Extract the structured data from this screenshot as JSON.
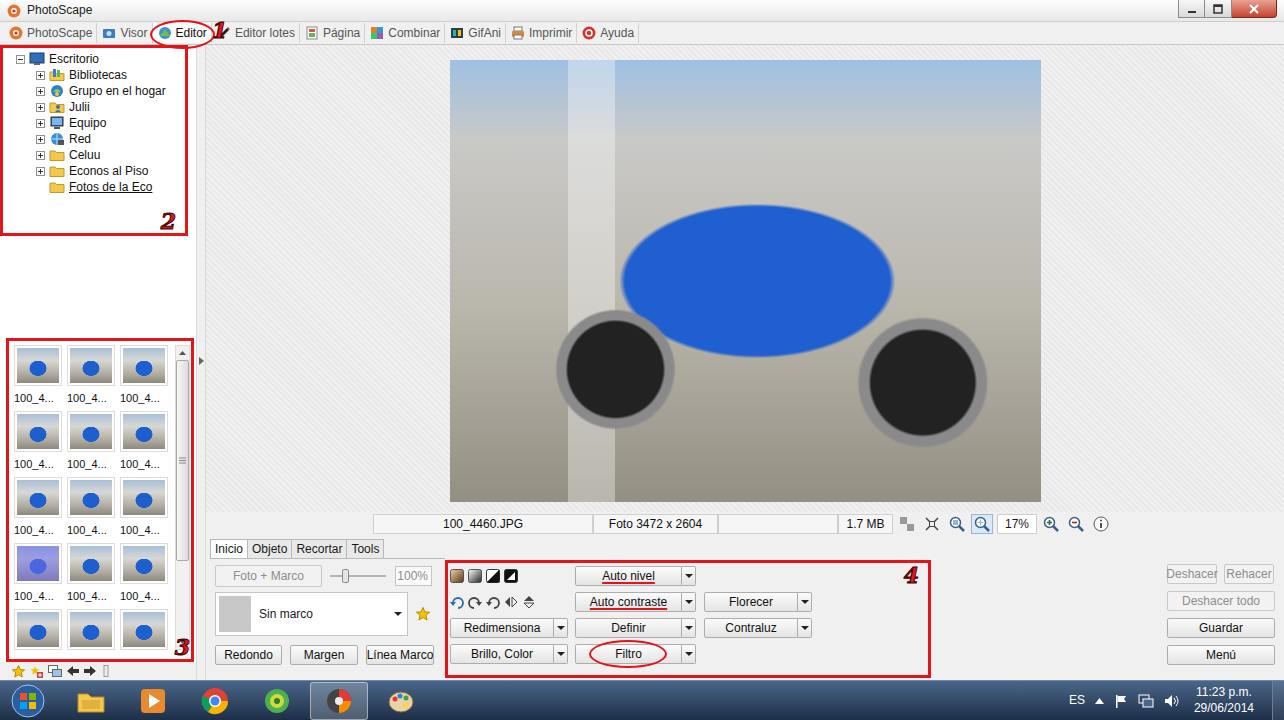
{
  "window": {
    "title": "PhotoScape"
  },
  "tabs": [
    {
      "label": "PhotoScape",
      "selected": false,
      "circled": false
    },
    {
      "label": "Visor",
      "selected": false,
      "circled": false
    },
    {
      "label": "Editor",
      "selected": true,
      "circled": true
    },
    {
      "label": "Editor lotes",
      "selected": false,
      "circled": false
    },
    {
      "label": "Página",
      "selected": false,
      "circled": false
    },
    {
      "label": "Combinar",
      "selected": false,
      "circled": false
    },
    {
      "label": "GifAni",
      "selected": false,
      "circled": false
    },
    {
      "label": "Imprimir",
      "selected": false,
      "circled": false
    },
    {
      "label": "Ayuda",
      "selected": false,
      "circled": false
    }
  ],
  "annotations": {
    "tabs": "1",
    "tree": "2",
    "thumbnails": "3",
    "tools": "4"
  },
  "tree": {
    "root": "Escritorio",
    "expanded": true,
    "items": [
      {
        "label": "Bibliotecas",
        "kind": "library",
        "expandable": true,
        "selected": false
      },
      {
        "label": "Grupo en el hogar",
        "kind": "homegroup",
        "expandable": true,
        "selected": false
      },
      {
        "label": "Julii",
        "kind": "user",
        "expandable": true,
        "selected": false
      },
      {
        "label": "Equipo",
        "kind": "computer",
        "expandable": true,
        "selected": false
      },
      {
        "label": "Red",
        "kind": "network",
        "expandable": true,
        "selected": false
      },
      {
        "label": "Celuu",
        "kind": "folder",
        "expandable": true,
        "selected": false
      },
      {
        "label": "Econos al Piso",
        "kind": "folder",
        "expandable": true,
        "selected": false
      },
      {
        "label": "Fotos de la Eco",
        "kind": "folder",
        "expandable": false,
        "selected": true
      }
    ]
  },
  "thumbnails": {
    "items": [
      {
        "label": "100_4...",
        "selected": false
      },
      {
        "label": "100_4...",
        "selected": false
      },
      {
        "label": "100_4...",
        "selected": false
      },
      {
        "label": "100_4...",
        "selected": false
      },
      {
        "label": "100_4...",
        "selected": false
      },
      {
        "label": "100_4...",
        "selected": false
      },
      {
        "label": "100_4...",
        "selected": false
      },
      {
        "label": "100_4...",
        "selected": false
      },
      {
        "label": "100_4...",
        "selected": false
      },
      {
        "label": "100_4...",
        "selected": true
      },
      {
        "label": "100_4...",
        "selected": false
      },
      {
        "label": "100_4...",
        "selected": false
      },
      {
        "selected": false
      },
      {
        "selected": false
      },
      {
        "selected": false
      }
    ],
    "scrollbar": {
      "level": 0.73
    }
  },
  "viewer": {
    "file": "100_4460.JPG",
    "dimensions": "Foto 3472 x 2604",
    "size": "1.7 MB",
    "zoom": "17%",
    "fit_selected": true
  },
  "panel": {
    "tabs": [
      {
        "label": "Inicio",
        "selected": true
      },
      {
        "label": "Objeto",
        "selected": false
      },
      {
        "label": "Recortar",
        "selected": false
      },
      {
        "label": "Tools",
        "selected": false
      }
    ],
    "frame_button": {
      "label": "Foto + Marco",
      "disabled": true
    },
    "slider": {
      "level": 0.25
    },
    "opacity": {
      "value": "100%",
      "disabled": true
    },
    "frame": "Sin marco",
    "buttons": [
      "Redondo",
      "Margen",
      "Línea Marco"
    ]
  },
  "tools": {
    "columns": [
      [
        {
          "label": "Redimensiona",
          "underlined": false,
          "circled": false
        },
        {
          "label": "Brillo, Color",
          "underlined": false,
          "circled": false
        }
      ],
      [
        {
          "label": "Auto nivel",
          "underlined": true,
          "circled": false
        },
        {
          "label": "Auto contraste",
          "underlined": true,
          "circled": false
        },
        {
          "label": "Definir",
          "underlined": false,
          "circled": false
        },
        {
          "label": "Filtro",
          "underlined": false,
          "circled": true
        }
      ],
      [
        {
          "label": "Florecer",
          "underlined": false,
          "circled": false
        },
        {
          "label": "Contraluz",
          "underlined": false,
          "circled": false
        }
      ]
    ]
  },
  "actions": [
    {
      "label": "Deshacer",
      "disabled": true
    },
    {
      "label": "Rehacer",
      "disabled": true
    },
    {
      "label": "Deshacer todo",
      "disabled": true
    },
    {
      "label": "Guardar",
      "disabled": false
    },
    {
      "label": "Menú",
      "disabled": false
    }
  ],
  "taskbar": {
    "apps": [
      {
        "kind": "explorer",
        "active": false
      },
      {
        "kind": "media",
        "active": false
      },
      {
        "kind": "chrome",
        "active": false
      },
      {
        "kind": "picasa",
        "active": false
      },
      {
        "kind": "photoscape",
        "active": true
      },
      {
        "kind": "paint",
        "active": false
      }
    ],
    "language": "ES",
    "time": "11:23 p.m.",
    "date": "29/06/2014"
  }
}
